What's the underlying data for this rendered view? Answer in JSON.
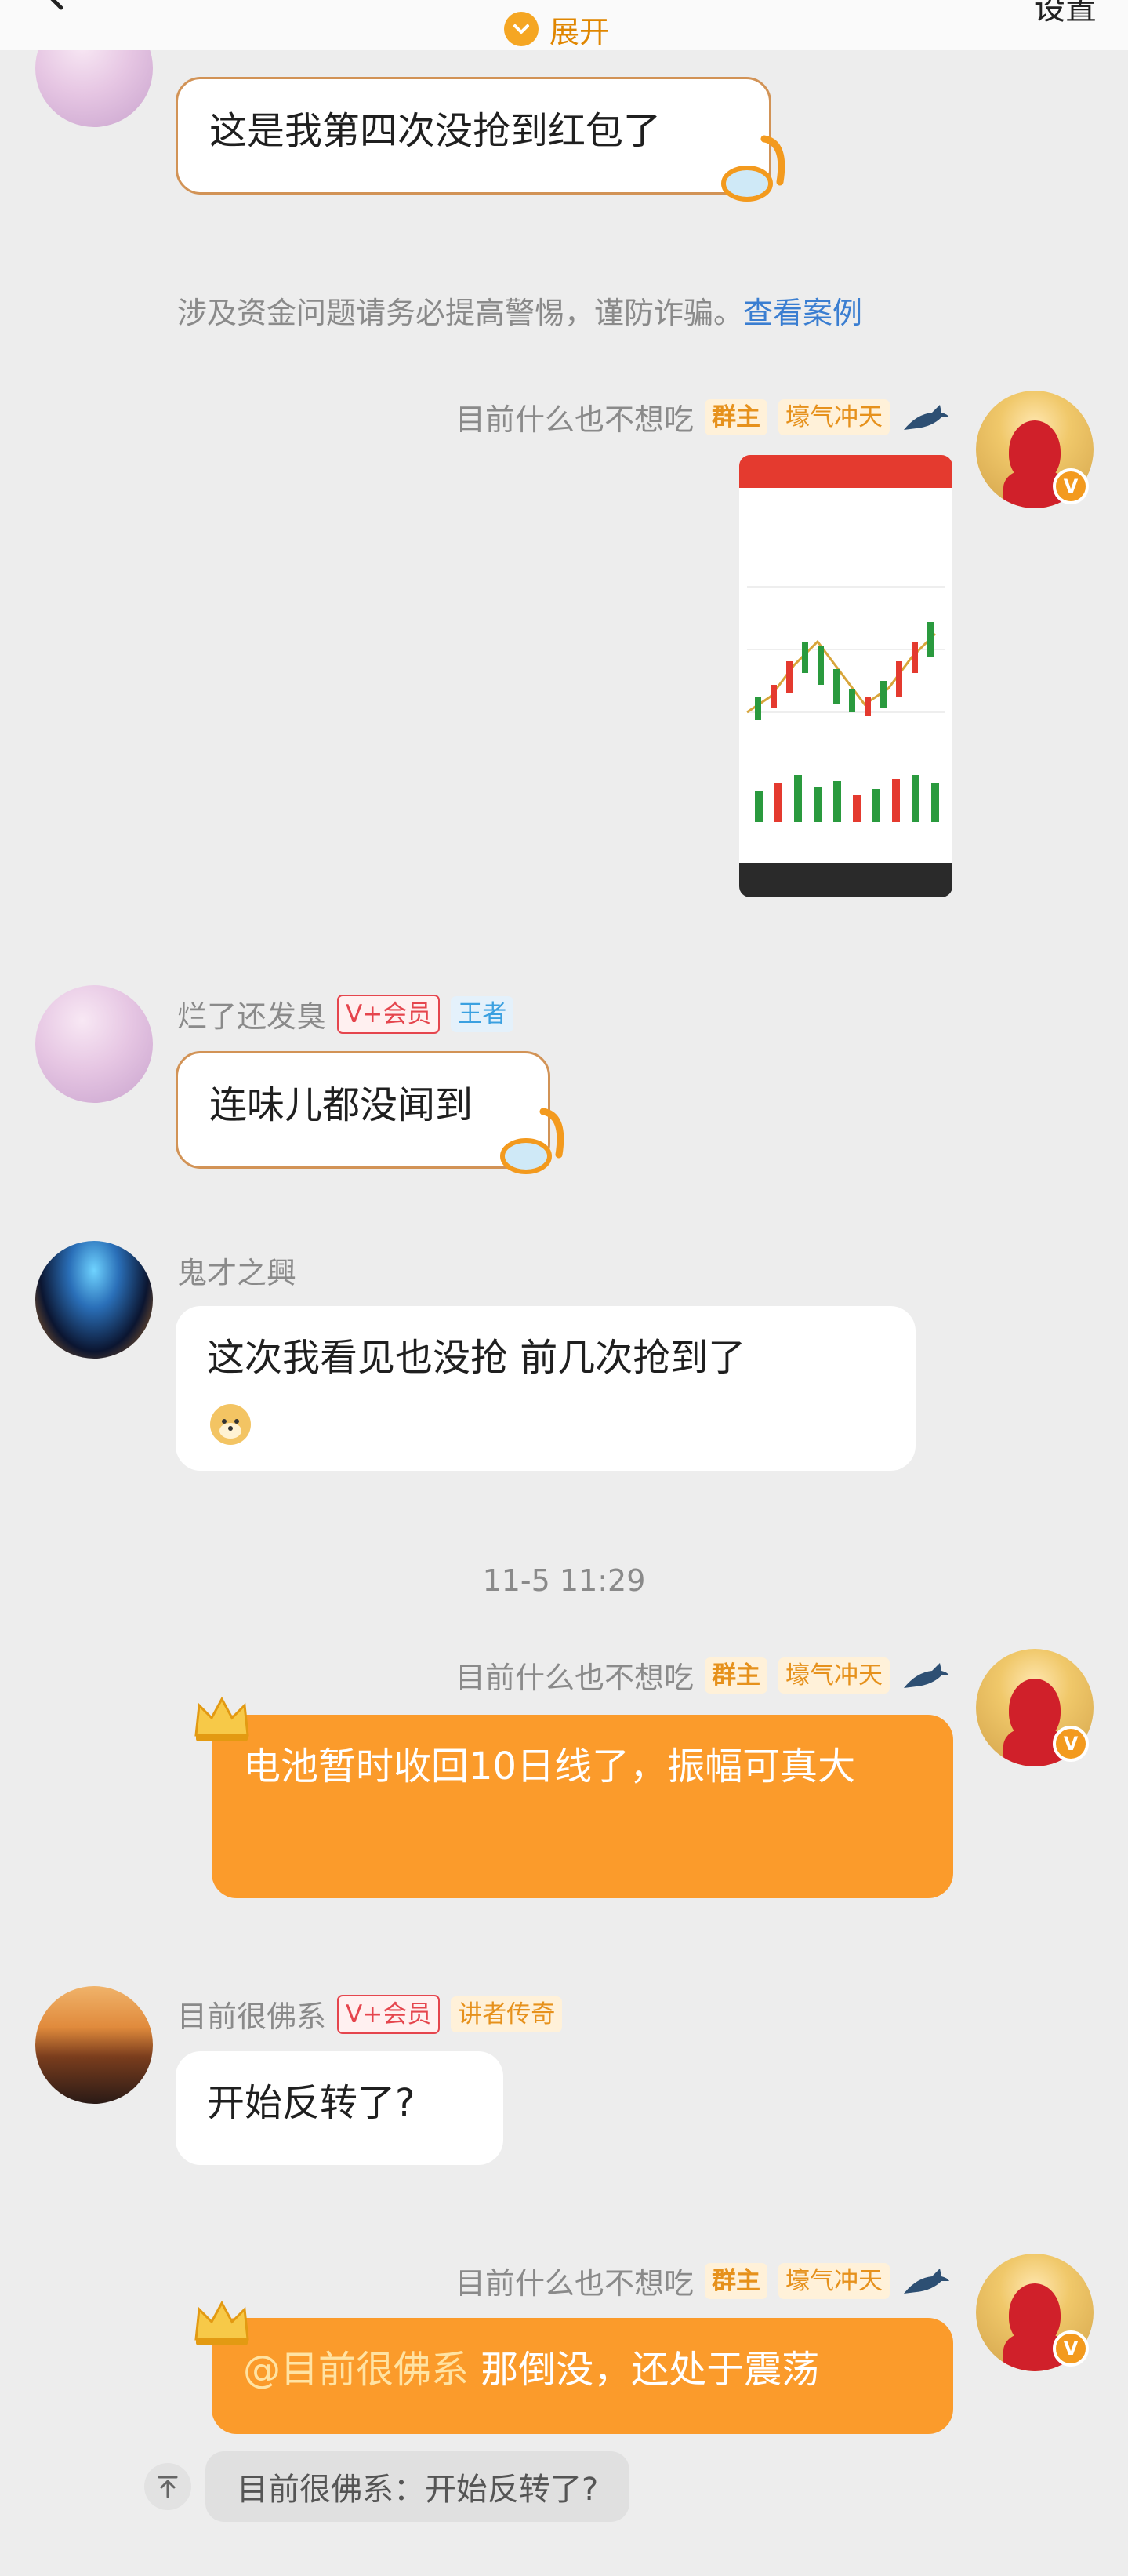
{
  "header": {
    "settings_label": "设置",
    "expand_label": "展开"
  },
  "messages": {
    "m1": {
      "text": "这是我第四次没抢到红包了"
    },
    "notice": {
      "text": "涉及资金问题请务必提高警惕，谨防诈骗。",
      "link": "查看案例"
    },
    "m2": {
      "sender": "目前什么也不想吃",
      "tag_owner": "群主",
      "tag_title": "壕气冲天"
    },
    "m3": {
      "sender": "烂了还发臭",
      "tag_vip": "V+会员",
      "tag_rank": "王者",
      "text": "连味儿都没闻到"
    },
    "m4": {
      "sender": "鬼才之興",
      "text": "这次我看见也没抢 前几次抢到了"
    },
    "timestamp": "11-5 11:29",
    "m5": {
      "sender": "目前什么也不想吃",
      "tag_owner": "群主",
      "tag_title": "壕气冲天",
      "text": "电池暂时收回10日线了，振幅可真大"
    },
    "m6": {
      "sender": "目前很佛系",
      "tag_vip": "V+会员",
      "tag_title": "讲者传奇",
      "text": "开始反转了?"
    },
    "m7": {
      "sender": "目前什么也不想吃",
      "tag_owner": "群主",
      "tag_title": "壕气冲天",
      "mention": "@目前很佛系",
      "text": " 那倒没，还处于震荡"
    },
    "quote": {
      "text": "目前很佛系：开始反转了?"
    }
  },
  "colors": {
    "accent_orange": "#fb9b2b",
    "link_blue": "#3a7ed1",
    "vip_red": "#e5454d",
    "background": "#ededed"
  },
  "icons": [
    "back-arrow-icon",
    "chevron-down-icon",
    "bird-icon",
    "crown-icon",
    "snorkel-mask-icon",
    "doge-emoji-icon",
    "verified-v-icon",
    "quote-up-icon"
  ]
}
